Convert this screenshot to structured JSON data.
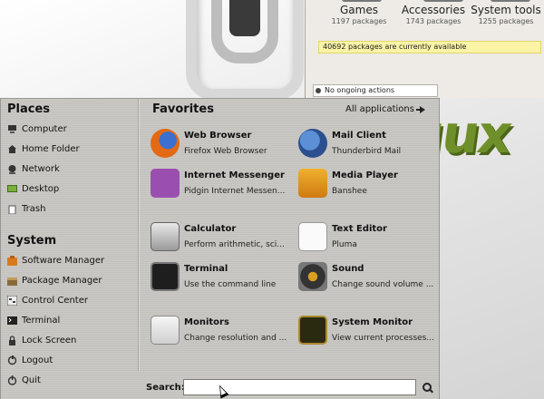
{
  "software_manager": {
    "categories": [
      {
        "name": "Games",
        "count": "1197 packages"
      },
      {
        "name": "Accessories",
        "count": "1743 packages"
      },
      {
        "name": "System tools",
        "count": "1255 packages"
      }
    ],
    "available_text": "40692 packages are currently available",
    "status_text": "No ongoing actions"
  },
  "menu": {
    "places": {
      "title": "Places",
      "items": [
        {
          "label": "Computer",
          "icon": "computer-icon"
        },
        {
          "label": "Home Folder",
          "icon": "home-folder-icon"
        },
        {
          "label": "Network",
          "icon": "network-icon"
        },
        {
          "label": "Desktop",
          "icon": "desktop-icon"
        },
        {
          "label": "Trash",
          "icon": "trash-icon"
        }
      ]
    },
    "system": {
      "title": "System",
      "items": [
        {
          "label": "Software Manager",
          "icon": "software-manager-icon"
        },
        {
          "label": "Package Manager",
          "icon": "package-manager-icon"
        },
        {
          "label": "Control Center",
          "icon": "control-center-icon"
        },
        {
          "label": "Terminal",
          "icon": "terminal-icon"
        },
        {
          "label": "Lock Screen",
          "icon": "lock-icon"
        },
        {
          "label": "Logout",
          "icon": "logout-icon"
        },
        {
          "label": "Quit",
          "icon": "quit-icon"
        }
      ]
    },
    "favorites": {
      "title": "Favorites",
      "all_apps_label": "All applications",
      "items": [
        {
          "name": "Web Browser",
          "desc": "Firefox Web Browser",
          "icon": "firefox-icon"
        },
        {
          "name": "Mail Client",
          "desc": "Thunderbird Mail",
          "icon": "thunderbird-icon"
        },
        {
          "name": "Internet Messenger",
          "desc": "Pidgin Internet Messen...",
          "icon": "pidgin-icon"
        },
        {
          "name": "Media Player",
          "desc": "Banshee",
          "icon": "banshee-icon"
        },
        {
          "name": "Calculator",
          "desc": "Perform arithmetic, sci...",
          "icon": "calculator-icon"
        },
        {
          "name": "Text Editor",
          "desc": "Pluma",
          "icon": "text-editor-icon"
        },
        {
          "name": "Terminal",
          "desc": "Use the command line",
          "icon": "terminal-icon"
        },
        {
          "name": "Sound",
          "desc": "Change sound volume ...",
          "icon": "sound-icon"
        },
        {
          "name": "Monitors",
          "desc": "Change resolution and ...",
          "icon": "monitors-icon"
        },
        {
          "name": "System Monitor",
          "desc": "View current processes...",
          "icon": "system-monitor-icon"
        }
      ]
    },
    "search": {
      "label": "Search:",
      "value": ""
    }
  },
  "colors": {
    "menu_bg": "#c7c5c1",
    "notice_bg": "#fbf3a6",
    "mint_green": "#6f8f2a"
  }
}
